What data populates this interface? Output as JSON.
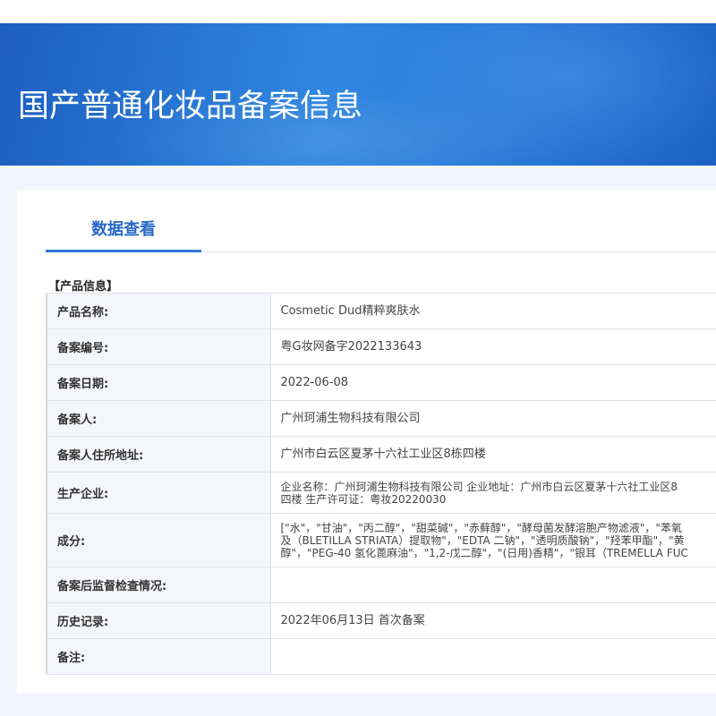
{
  "header": {
    "title": "国产普通化妆品备案信息"
  },
  "tabs": [
    {
      "label": "数据查看",
      "active": true
    }
  ],
  "section": {
    "title": "【产品信息】"
  },
  "fields": {
    "product_name": {
      "label": "产品名称:",
      "value": "Cosmetic Dud精粹爽肤水"
    },
    "record_no": {
      "label": "备案编号:",
      "value": "粤G妆网备字2022133643"
    },
    "record_date": {
      "label": "备案日期:",
      "value": "2022-06-08"
    },
    "registrant": {
      "label": "备案人:",
      "value": "广州珂浦生物科技有限公司"
    },
    "registrant_address": {
      "label": "备案人住所地址:",
      "value": "广州市白云区夏茅十六社工业区8栋四楼"
    },
    "manufacturer": {
      "label": "生产企业:",
      "line1": "企业名称：广州珂浦生物科技有限公司 企业地址：广州市白云区夏茅十六社工业区8",
      "line2": "四楼 生产许可证：粤妆20220030"
    },
    "ingredients": {
      "label": "成分:",
      "line1": "[\"水\"，\"甘油\"，\"丙二醇\"，\"甜菜碱\"，\"赤藓醇\"，\"酵母菌发酵溶胞产物滤液\"，\"苯氧",
      "line2": "及（BLETILLA STRIATA）提取物\"，\"EDTA 二钠\"，\"透明质酸钠\"，\"羟苯甲酯\"，\"黄",
      "line3": "醇\"，\"PEG-40 氢化蓖麻油\"，\"1,2-戊二醇\"，\"(日用)香精\"，\"银耳（TREMELLA FUC"
    },
    "post_inspection": {
      "label": "备案后监督检查情况:",
      "value": ""
    },
    "history": {
      "label": "历史记录:",
      "value": "2022年06月13日 首次备案"
    },
    "remarks": {
      "label": "备注:",
      "value": ""
    }
  },
  "colors": {
    "banner": "#2a7ad8",
    "accent": "#2768c8",
    "label_bg": "#f4f6f9"
  }
}
